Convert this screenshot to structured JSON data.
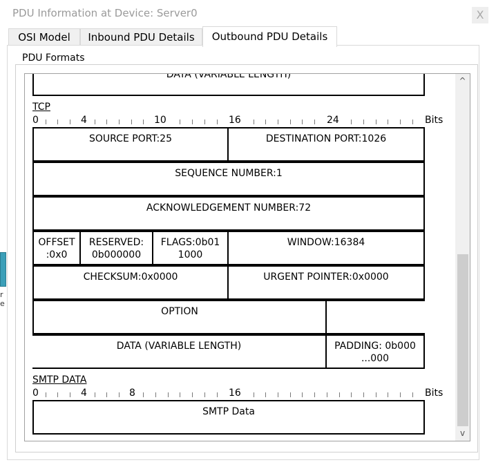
{
  "window": {
    "title": "PDU Information at Device: Server0",
    "close_label": "X"
  },
  "tabs": [
    "OSI Model",
    "Inbound PDU Details",
    "Outbound PDU Details"
  ],
  "group_label": "PDU Formats",
  "top_cut_label": "DATA (VARIABLE LENGTH)",
  "side_text": [
    "r",
    "e"
  ],
  "scroll": {
    "up": "^",
    "down": "v"
  },
  "tcp": {
    "title": "TCP",
    "ruler": [
      "0",
      "4",
      "10",
      "16",
      "24",
      "Bits"
    ],
    "source_port": "SOURCE PORT:25",
    "destination_port": "DESTINATION PORT:1026",
    "sequence": "SEQUENCE NUMBER:1",
    "ack": "ACKNOWLEDGEMENT NUMBER:72",
    "offset_l1": "OFFSET",
    "offset_l2": ":0x0",
    "reserved_l1": "RESERVED:",
    "reserved_l2": "0b000000",
    "flags_l1": "FLAGS:0b01",
    "flags_l2": "1000",
    "window": "WINDOW:16384",
    "checksum": "CHECKSUM:0x0000",
    "urgent": "URGENT POINTER:0x0000",
    "option": "OPTION",
    "data": "DATA (VARIABLE LENGTH)",
    "padding_l1": "PADDING: 0b000",
    "padding_l2": "...000"
  },
  "smtp": {
    "title": "SMTP DATA",
    "ruler": [
      "0",
      "4",
      "8",
      "16",
      "Bits"
    ],
    "data": "SMTP Data"
  }
}
